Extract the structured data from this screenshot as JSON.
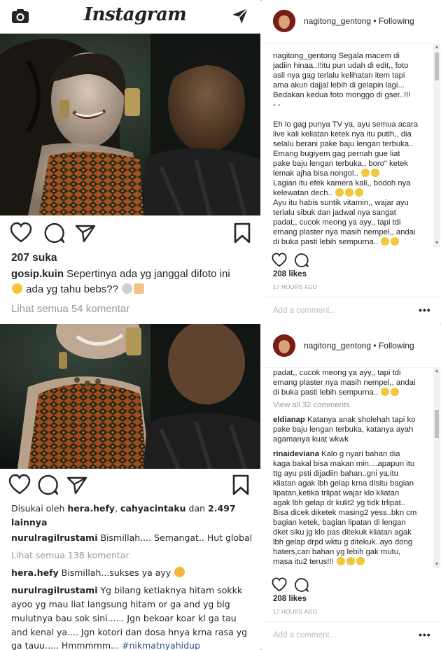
{
  "app": {
    "logo_text": "Instagram"
  },
  "post1": {
    "likes_text": "207 suka",
    "caption_user": "gosip.kuin",
    "caption_text": " Sepertinya ada yg janggal difoto ini",
    "caption_line2": " ada yg tahu bebs??",
    "view_comments": "Lihat semua 54 komentar"
  },
  "post2": {
    "liked_by_prefix": "Disukai oleh ",
    "liked_by_user1": "hera.hefy",
    "liked_by_sep": ", ",
    "liked_by_user2": "cahyacintaku",
    "liked_by_mid": " dan ",
    "liked_by_count": "2.497",
    "liked_by_suffix": "lainnya",
    "caption_user": "nurulragilrustami",
    "caption_text": " Bismillah.... Semangat.. Hut global",
    "view_comments": "Lihat semua 138 komentar",
    "comment1_user": "hera.hefy",
    "comment1_text": " Bismillah...sukses ya ayy",
    "comment2_user": "nurulragilrustami",
    "comment2_lines": [
      " Yg bilang ketiaknya hitam sokkk",
      "ayoo yg mau liat langsung hitam or ga and yg blg",
      "mulutnya bau sok sini...... Jgn bekoar koar kl ga tau",
      "and kenal ya.... Jgn kotori dan dosa hnya krna rasa yg",
      "ga tauu..... Hmmmmm... "
    ],
    "comment2_tag": "#nikmatnyahidup"
  },
  "panel1": {
    "username": "nagitong_gentong",
    "follow_sep": " • ",
    "follow_status": "Following",
    "lines": [
      "nagitong_gentong Segala macem di",
      "jadiin hinaa..!!itu pun udah di edit,, foto",
      "asli nya gag terlalu kelihatan item tapi",
      "ama akun dajjal lebih di gelapin lagi...",
      "Bedakan kedua foto monggo di gser..!!!",
      "- -",
      "",
      "Eh lo gag punya TV ya, ayu semua acara",
      "live kali keliatan ketek nya itu putih,, dia",
      "selalu berani pake baju lengan terbuka..",
      "Emang bugiyem gag pernah gue liat",
      "pake baju lengan terbuka,, boro\" ketek",
      "lemak ajha bisa nongol..",
      "Lagian itu efek kamera kali,, bodoh nya",
      "kelewatan dech..",
      "Ayu itu habis suntik vitamin,, wajar ayu",
      "terlalu sibuk dan jadwal nya sangat",
      "padat,, cucok meong ya ayy,, tapi tdi",
      "emang plaster nya masih nempel,, andai",
      "di buka pasti lebih sempurna.."
    ],
    "likes": "208 likes",
    "time": "17 HOURS AGO",
    "comment_placeholder": "Add a comment...",
    "more_dots": "•••"
  },
  "panel2": {
    "username": "nagitong_gentong",
    "follow_sep": " • ",
    "follow_status": "Following",
    "lines": [
      "padat,, cucok meong ya ayy,, tapi tdi",
      "emang plaster nya masih nempel,, andai",
      "di buka pasti lebih sempurna.."
    ],
    "view_all": "View all 32 comments",
    "c1_user": "eldianap",
    "c1_lines": [
      " Katanya anak sholehah tapi ko",
      "pake baju lengan terbuka, katanya ayah",
      "agamanya kuat wkwk"
    ],
    "c2_user": "rinaideviana",
    "c2_lines": [
      " Kalo g nyari bahan dia",
      "kaga bakal bisa makan min....apapun itu",
      "ttg ayu psti dijadiin bahan..gni ya,itu",
      "kliatan agak lbh gelap krna disitu bagian",
      "lipatan,ketika trlipat wajar klo kliatan",
      "agak lbh gelap dr kulit2 yg tidk trlipat..",
      "Bisa dicek diketek masing2 yess..bkn cm",
      "bagian ketek, bagian lipatan di lengan",
      "dket siku jg klo pas ditekuk kliatan agak",
      "lbh gelap drpd wktu g ditekuk..ayo dong",
      "haters,cari bahan yg lebih gak mutu,",
      "masa itu2 terus!!!"
    ],
    "likes": "208 likes",
    "time": "17 HOURS AGO",
    "comment_placeholder": "Add a comment...",
    "more_dots": "•••"
  }
}
